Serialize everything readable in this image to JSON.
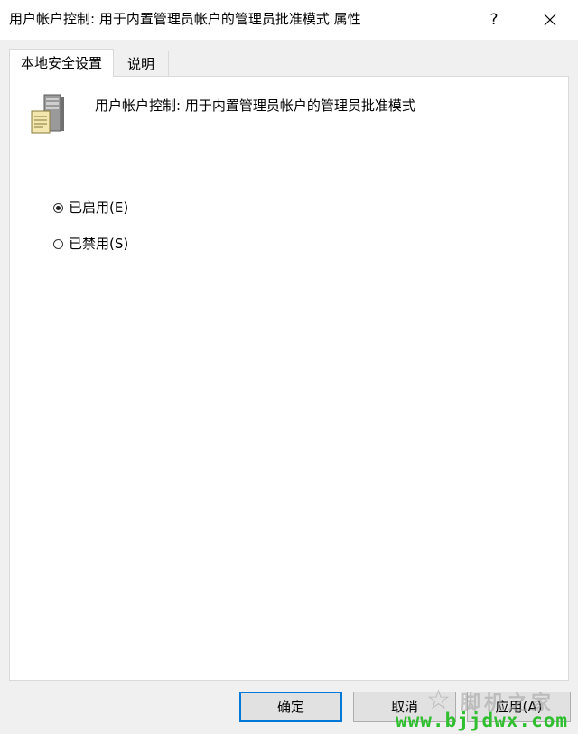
{
  "window": {
    "title": "用户帐户控制: 用于内置管理员帐户的管理员批准模式 属性",
    "help_label": "?",
    "close_icon": "close-icon"
  },
  "tabs": [
    {
      "label": "本地安全设置",
      "active": true
    },
    {
      "label": "说明",
      "active": false
    }
  ],
  "policy": {
    "icon": "server-policy-icon",
    "name": "用户帐户控制: 用于内置管理员帐户的管理员批准模式"
  },
  "options": [
    {
      "label": "已启用(E)",
      "checked": true
    },
    {
      "label": "已禁用(S)",
      "checked": false
    }
  ],
  "buttons": {
    "ok": "确定",
    "cancel": "取消",
    "apply": "应用(A)"
  },
  "watermark": {
    "text_cn": "脚机之家",
    "url": "www.bjjdwx.com"
  },
  "colors": {
    "focus_border": "#0078d7",
    "watermark_green": "#2fbf2f"
  }
}
